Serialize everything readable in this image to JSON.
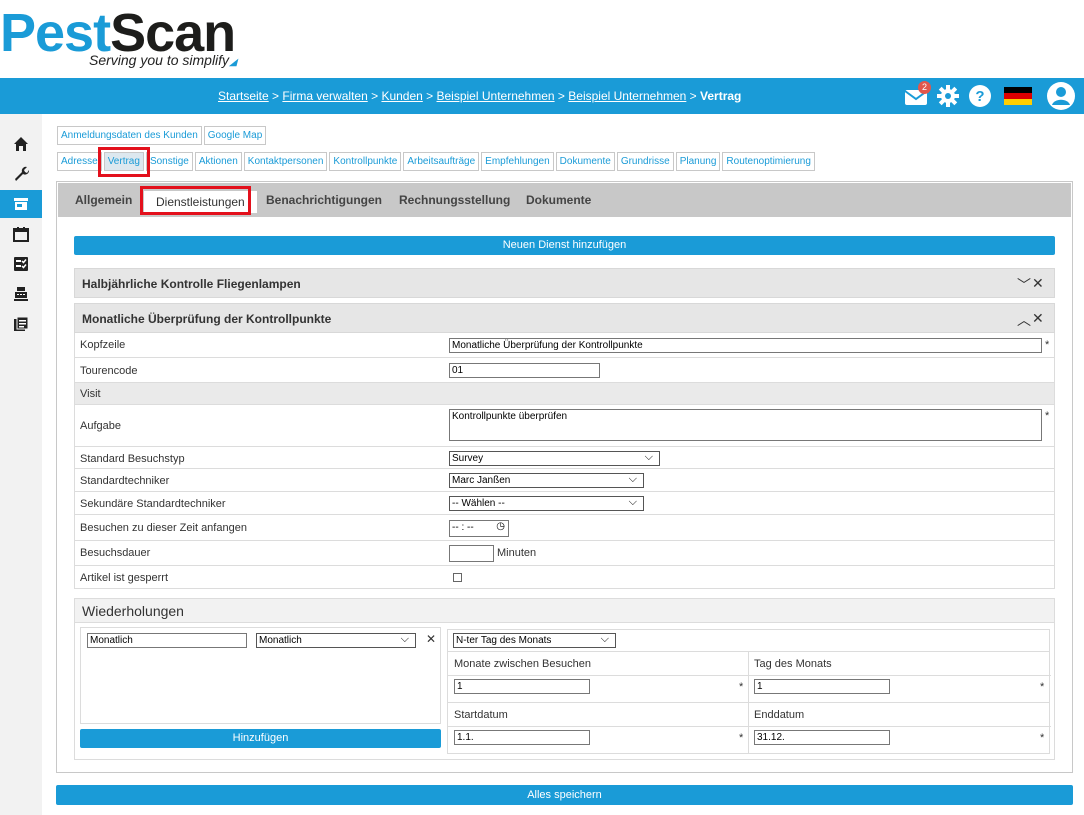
{
  "logo": {
    "pest": "Pest",
    "scan": "Scan",
    "tagline": "Serving you to simplify"
  },
  "breadcrumb": {
    "items": [
      "Startseite",
      "Firma verwalten",
      "Kunden",
      "Beispiel Unternehmen",
      "Beispiel Unternehmen"
    ],
    "separator": " > ",
    "current": "Vertrag"
  },
  "topbar": {
    "mail_badge": "2",
    "accent": "#1a9bd7"
  },
  "customer_tabs_row1": [
    "Anmeldungsdaten des Kunden",
    "Google Map"
  ],
  "customer_tabs_row2": [
    "Adresse",
    "Vertrag",
    "Sonstige",
    "Aktionen",
    "Kontaktpersonen",
    "Kontrollpunkte",
    "Arbeitsaufträge",
    "Empfehlungen",
    "Dokumente",
    "Grundrisse",
    "Planung",
    "Routenoptimierung"
  ],
  "subtabs": [
    "Allgemein",
    "Dienstleistungen",
    "Benachrichtigungen",
    "Rechnungsstellung",
    "Dokumente"
  ],
  "add_service_label": "Neuen Dienst hinzufügen",
  "accordion": {
    "collapsed_title": "Halbjährliche Kontrolle Fliegenlampen",
    "expanded_title": "Monatliche Überprüfung der Kontrollpunkte"
  },
  "form": {
    "kopfzeile_label": "Kopfzeile",
    "kopfzeile_value": "Monatliche Überprüfung der Kontrollpunkte",
    "tourencode_label": "Tourencode",
    "tourencode_value": "01",
    "visit_label": "Visit",
    "aufgabe_label": "Aufgabe",
    "aufgabe_value": "Kontrollpunkte überprüfen",
    "besuchstyp_label": "Standard Besuchstyp",
    "besuchstyp_value": "Survey",
    "techniker_label": "Standardtechniker",
    "techniker_value": "Marc Janßen",
    "sek_techniker_label": "Sekundäre Standardtechniker",
    "sek_techniker_value": "-- Wählen --",
    "startzeit_label": "Besuchen zu dieser Zeit anfangen",
    "startzeit_value": "-- : --",
    "dauer_label": "Besuchsdauer",
    "dauer_unit": "Minuten",
    "gesperrt_label": "Artikel ist gesperrt",
    "required_mark": "*"
  },
  "wiederholungen": {
    "title": "Wiederholungen",
    "name_value": "Monatlich",
    "type_value": "Monatlich",
    "remove_label": "✕",
    "add_label": "Hinzufügen",
    "mode_value": "N-ter Tag des Monats",
    "months_label": "Monate zwischen Besuchen",
    "months_value": "1",
    "day_label": "Tag des Monats",
    "day_value": "1",
    "start_label": "Startdatum",
    "start_value": "1.1.",
    "end_label": "Enddatum",
    "end_value": "31.12."
  },
  "save_all_label": "Alles speichern"
}
